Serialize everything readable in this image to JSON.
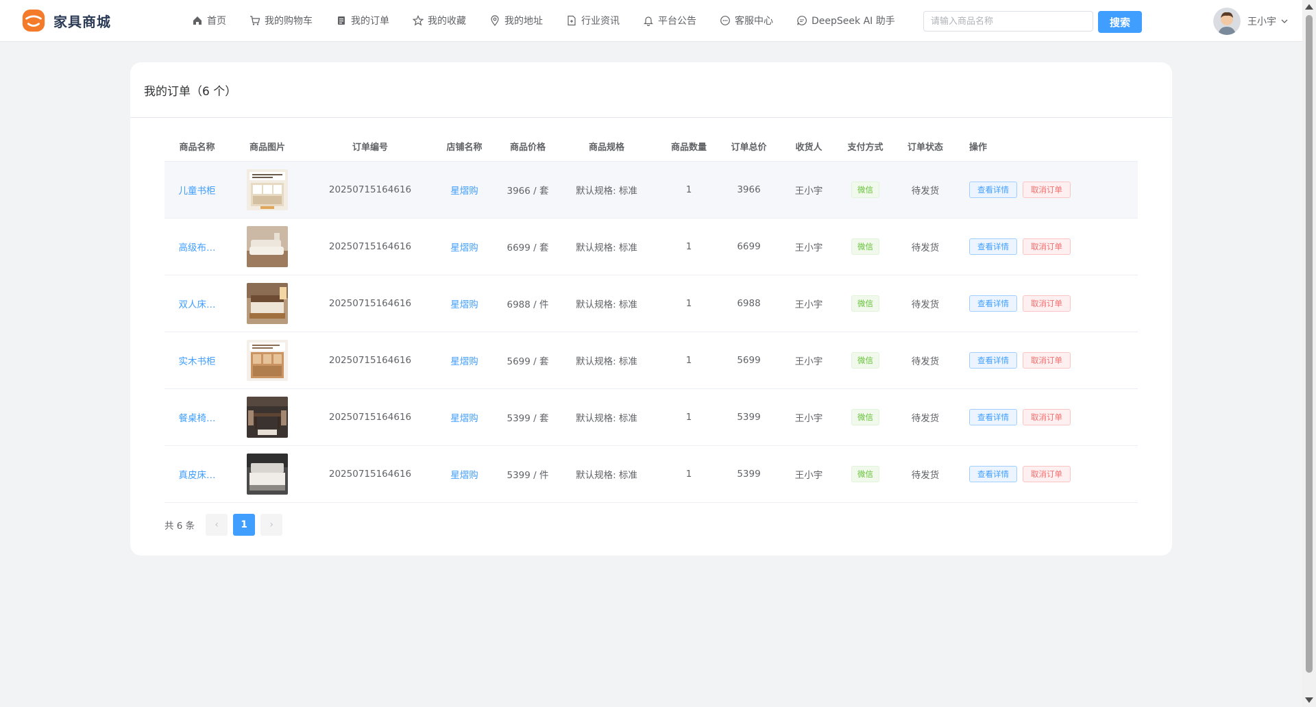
{
  "header": {
    "logo_text": "家具商城",
    "nav": [
      {
        "label": "首页",
        "icon": "home-icon"
      },
      {
        "label": "我的购物车",
        "icon": "cart-icon"
      },
      {
        "label": "我的订单",
        "icon": "order-icon"
      },
      {
        "label": "我的收藏",
        "icon": "star-icon"
      },
      {
        "label": "我的地址",
        "icon": "location-icon"
      },
      {
        "label": "行业资讯",
        "icon": "document-icon"
      },
      {
        "label": "平台公告",
        "icon": "bell-icon"
      },
      {
        "label": "客服中心",
        "icon": "chat-icon"
      },
      {
        "label": "DeepSeek AI 助手",
        "icon": "ai-chat-icon"
      }
    ],
    "search_placeholder": "请输入商品名称",
    "search_button": "搜索",
    "user_name": "王小宇"
  },
  "orders": {
    "title": "我的订单（6 个）",
    "columns": [
      "商品名称",
      "商品图片",
      "订单编号",
      "店铺名称",
      "商品价格",
      "商品规格",
      "商品数量",
      "订单总价",
      "收货人",
      "支付方式",
      "订单状态",
      "操作"
    ],
    "rows": [
      {
        "name": "儿童书柜",
        "order_no": "20250715164616",
        "shop": "星熠购",
        "price": "3966 / 套",
        "spec": "默认规格: 标准",
        "qty": "1",
        "total": "3966",
        "receiver": "王小宇",
        "payment": "微信",
        "status": "待发货",
        "image": "kids-bookcase-image"
      },
      {
        "name": "高级布…",
        "order_no": "20250715164616",
        "shop": "星熠购",
        "price": "6699 / 套",
        "spec": "默认规格: 标准",
        "qty": "1",
        "total": "6699",
        "receiver": "王小宇",
        "payment": "微信",
        "status": "待发货",
        "image": "fabric-sofa-image"
      },
      {
        "name": "双人床…",
        "order_no": "20250715164616",
        "shop": "星熠购",
        "price": "6988 / 件",
        "spec": "默认规格: 标准",
        "qty": "1",
        "total": "6988",
        "receiver": "王小宇",
        "payment": "微信",
        "status": "待发货",
        "image": "double-bed-image"
      },
      {
        "name": "实木书柜",
        "order_no": "20250715164616",
        "shop": "星熠购",
        "price": "5699 / 套",
        "spec": "默认规格: 标准",
        "qty": "1",
        "total": "5699",
        "receiver": "王小宇",
        "payment": "微信",
        "status": "待发货",
        "image": "wood-bookcase-image"
      },
      {
        "name": "餐桌椅…",
        "order_no": "20250715164616",
        "shop": "星熠购",
        "price": "5399 / 套",
        "spec": "默认规格: 标准",
        "qty": "1",
        "total": "5399",
        "receiver": "王小宇",
        "payment": "微信",
        "status": "待发货",
        "image": "dining-set-image"
      },
      {
        "name": "真皮床…",
        "order_no": "20250715164616",
        "shop": "星熠购",
        "price": "5399 / 件",
        "spec": "默认规格: 标准",
        "qty": "1",
        "total": "5399",
        "receiver": "王小宇",
        "payment": "微信",
        "status": "待发货",
        "image": "leather-bed-image"
      }
    ],
    "action_view": "查看详情",
    "action_cancel": "取消订单"
  },
  "pagination": {
    "total_text": "共 6 条",
    "current_page": "1",
    "prev": "‹",
    "next": "›"
  },
  "colors": {
    "primary": "#409eff",
    "danger": "#f56c6c",
    "success": "#67c23a",
    "logo_orange": "#f47b2a"
  }
}
